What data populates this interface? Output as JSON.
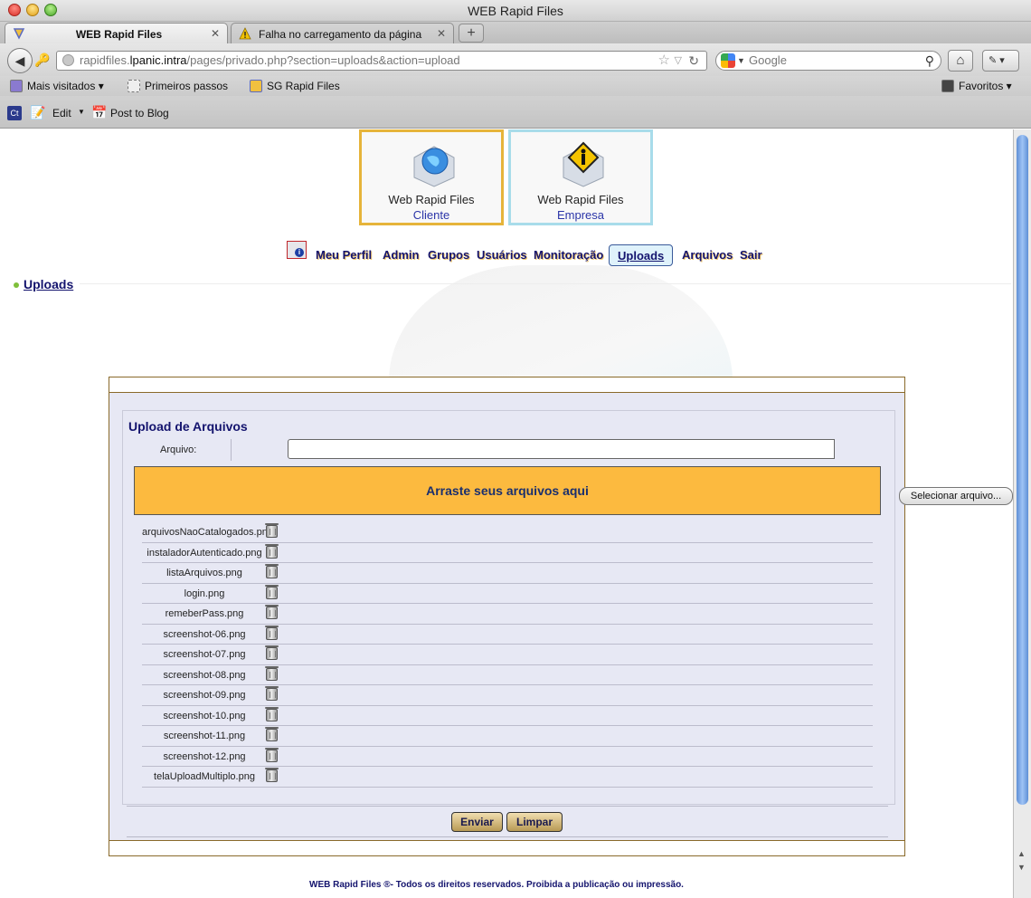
{
  "window": {
    "title": "WEB Rapid Files"
  },
  "tabs": [
    {
      "label": "WEB Rapid Files",
      "active": true
    },
    {
      "label": "Falha no carregamento da página",
      "active": false
    }
  ],
  "address": {
    "url_prefix": "rapidfiles.",
    "url_host": "lpanic.intra",
    "url_path": "/pages/privado.php?section=uploads&action=upload"
  },
  "search": {
    "placeholder": "Google"
  },
  "bookmarks": [
    {
      "label": "Mais visitados ▾"
    },
    {
      "label": "Primeiros passos"
    },
    {
      "label": "SG Rapid Files"
    },
    {
      "label": "Favoritos ▾"
    }
  ],
  "toolbar": {
    "ct": "Ct",
    "edit_label": "Edit",
    "post_label": "Post to Blog"
  },
  "header": {
    "cliente": {
      "name": "Web Rapid Files",
      "sub": "Cliente"
    },
    "empresa": {
      "name": "Web Rapid Files",
      "sub": "Empresa"
    }
  },
  "menu": [
    {
      "label": "Meu Perfil"
    },
    {
      "label": "Admin"
    },
    {
      "label": "Grupos"
    },
    {
      "label": "Usuários"
    },
    {
      "label": "Monitoração"
    },
    {
      "label": "Uploads",
      "active": true
    },
    {
      "label": "Arquivos"
    },
    {
      "label": "Sair"
    }
  ],
  "section": {
    "title": "Uploads"
  },
  "upload": {
    "legend": "Upload de Arquivos",
    "file_label": "Arquivo:",
    "select_button": "Selecionar arquivo...",
    "dropzone": "Arraste seus arquivos aqui",
    "files": [
      "arquivosNaoCatalogados.png",
      "instaladorAutenticado.png",
      "listaArquivos.png",
      "login.png",
      "remeberPass.png",
      "screenshot-06.png",
      "screenshot-07.png",
      "screenshot-08.png",
      "screenshot-09.png",
      "screenshot-10.png",
      "screenshot-11.png",
      "screenshot-12.png",
      "telaUploadMultiplo.png"
    ],
    "send_button": "Enviar",
    "clear_button": "Limpar"
  },
  "footer": {
    "text": "WEB Rapid Files ®- Todos os direitos reservados. Proibida a publicação ou impressão."
  },
  "colors": {
    "accent": "#fcba3f",
    "nav_text": "#14146e",
    "panel_bg": "#e7e8f4"
  }
}
